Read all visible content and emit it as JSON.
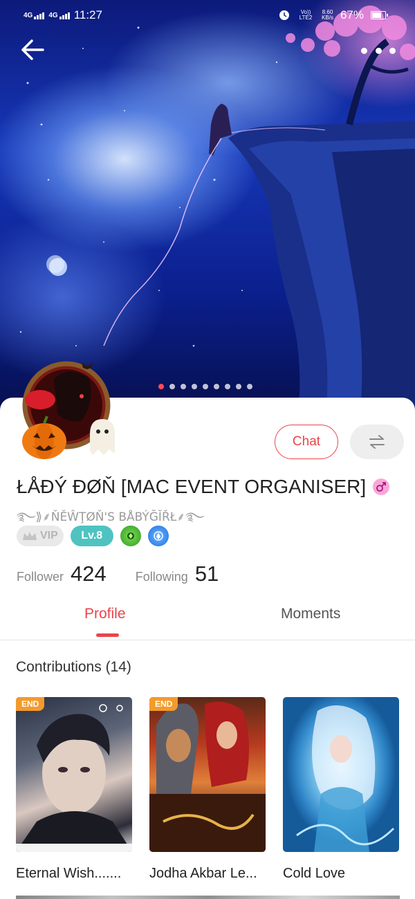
{
  "status_bar": {
    "network_1": "4G",
    "network_2": "4G",
    "time": "11:27",
    "volte": "Vo)) LTE2",
    "speed_value": "8.60",
    "speed_unit": "KB/s",
    "battery": "67%",
    "battery_level": 0.67
  },
  "cover": {
    "slide_count": 9,
    "active_slide": 1
  },
  "icons": {
    "back": "arrow-left-icon",
    "more": "more-dots-icon",
    "switch": "swap-arrows-icon",
    "gender": "female-gender-icon",
    "vip": "crown-icon"
  },
  "profile": {
    "username": "ŁÅĐÝ ĐØŇ [MAC EVENT ORGANISER]",
    "subtitle": "࿐⟫⸙ŇĚŴŢØŇ'S BÅBÝĞĬŘŁ⸙࿐",
    "chat_label": "Chat",
    "vip_label": "VIP",
    "level_label": "Lv.8",
    "stats": {
      "follower_label": "Follower",
      "follower_value": "424",
      "following_label": "Following",
      "following_value": "51"
    }
  },
  "tabs": {
    "profile": "Profile",
    "moments": "Moments"
  },
  "contributions": {
    "title": "Contributions (14)",
    "items": [
      {
        "title": "Eternal Wish.......",
        "badge": "END"
      },
      {
        "title": "Jodha Akbar Le...",
        "badge": "END"
      },
      {
        "title": "Cold Love",
        "badge": ""
      }
    ]
  },
  "colors": {
    "accent": "#e8454b",
    "level_badge": "#4fc3c1",
    "end_badge": "#f39a2b",
    "active_dot": "#ff4b55"
  }
}
